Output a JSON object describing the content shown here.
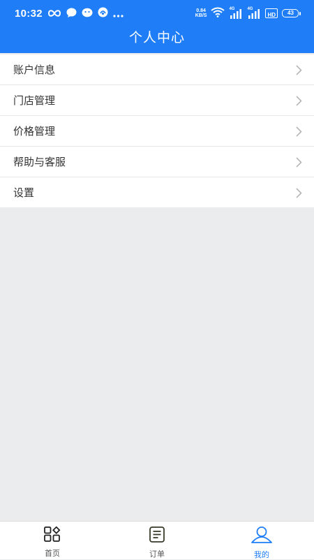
{
  "status_bar": {
    "time": "10:32",
    "net_speed_value": "0.84",
    "net_speed_unit": "KB/S",
    "signal_1_label": "4G",
    "signal_2_label": "4G",
    "hd_label": "HD",
    "battery": "43",
    "left_icons": [
      "infinity-icon",
      "chat-bubble-icon",
      "wechat-icon",
      "app-icon",
      "more-dots-icon"
    ],
    "right_icons": [
      "wifi-icon",
      "signal-icon",
      "signal-icon",
      "hd-icon",
      "battery-icon"
    ]
  },
  "header": {
    "title": "个人中心"
  },
  "menu": {
    "items": [
      {
        "label": "账户信息",
        "icon": "chevron-right-icon"
      },
      {
        "label": "门店管理",
        "icon": "chevron-right-icon"
      },
      {
        "label": "价格管理",
        "icon": "chevron-right-icon"
      },
      {
        "label": "帮助与客服",
        "icon": "chevron-right-icon"
      },
      {
        "label": "设置",
        "icon": "chevron-right-icon"
      }
    ]
  },
  "tabbar": {
    "tabs": [
      {
        "label": "首页",
        "icon": "home-grid-icon",
        "active": false
      },
      {
        "label": "订单",
        "icon": "order-list-icon",
        "active": false
      },
      {
        "label": "我的",
        "icon": "user-profile-icon",
        "active": true
      }
    ]
  },
  "colors": {
    "primary": "#1f7ef7",
    "background": "#ebeced",
    "text": "#333333",
    "chevron": "#b0b0b0"
  }
}
